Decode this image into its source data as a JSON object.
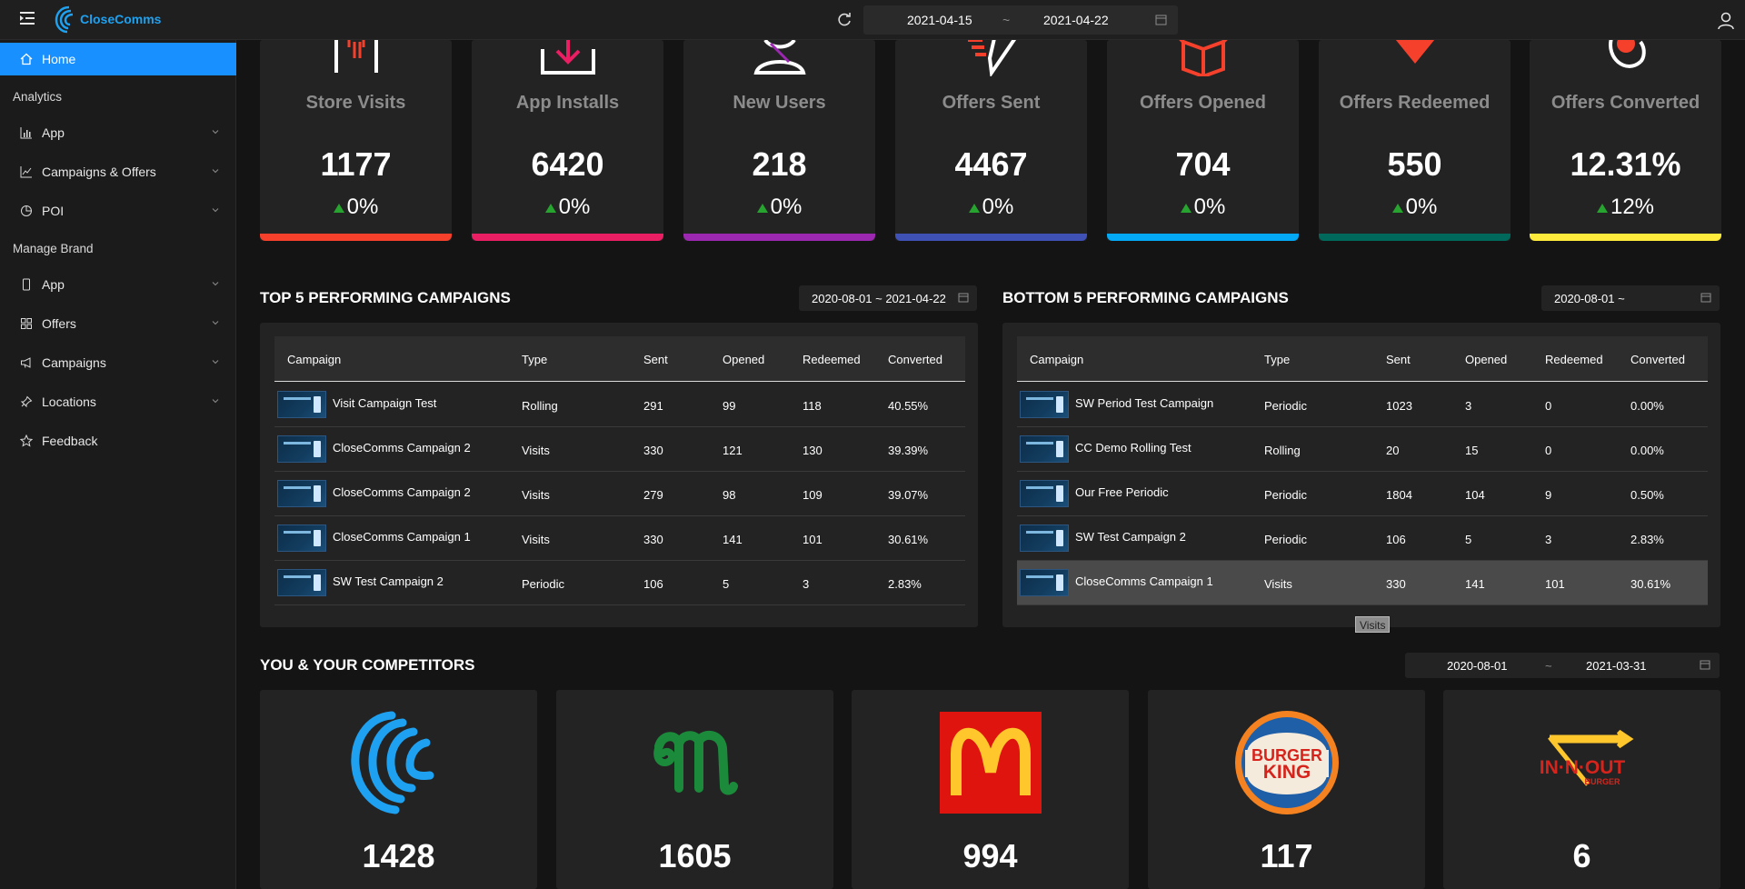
{
  "brand": {
    "name": "CloseComms"
  },
  "header": {
    "date_from": "2021-04-15",
    "date_sep": "~",
    "date_to": "2021-04-22"
  },
  "sidebar": {
    "home": "Home",
    "analytics_label": "Analytics",
    "analytics_items": [
      {
        "label": "App",
        "icon": "bar-chart-icon"
      },
      {
        "label": "Campaigns & Offers",
        "icon": "line-chart-icon"
      },
      {
        "label": "POI",
        "icon": "pie-chart-icon"
      }
    ],
    "manage_label": "Manage Brand",
    "manage_items": [
      {
        "label": "App",
        "icon": "mobile-icon"
      },
      {
        "label": "Offers",
        "icon": "grid-icon"
      },
      {
        "label": "Campaigns",
        "icon": "megaphone-icon"
      },
      {
        "label": "Locations",
        "icon": "pin-icon"
      }
    ],
    "feedback": "Feedback"
  },
  "stats": [
    {
      "title": "Store Visits",
      "value": "1177",
      "change": "0%",
      "color": "#f5402c"
    },
    {
      "title": "App Installs",
      "value": "6420",
      "change": "0%",
      "color": "#e91e63"
    },
    {
      "title": "New Users",
      "value": "218",
      "change": "0%",
      "color": "#9c27b0"
    },
    {
      "title": "Offers Sent",
      "value": "4467",
      "change": "0%",
      "color": "#3f51b5"
    },
    {
      "title": "Offers Opened",
      "value": "704",
      "change": "0%",
      "color": "#03a9f4"
    },
    {
      "title": "Offers Redeemed",
      "value": "550",
      "change": "0%",
      "color": "#00695c"
    },
    {
      "title": "Offers Converted",
      "value": "12.31%",
      "change": "12%",
      "color": "#ffeb3b"
    }
  ],
  "top5": {
    "title": "TOP 5 PERFORMING CAMPAIGNS",
    "range": "2020-08-01 ~ 2021-04-22",
    "columns": [
      "Campaign",
      "Type",
      "Sent",
      "Opened",
      "Redeemed",
      "Converted"
    ],
    "rows": [
      {
        "campaign": "Visit Campaign Test",
        "type": "Rolling",
        "sent": "291",
        "opened": "99",
        "redeemed": "118",
        "converted": "40.55%"
      },
      {
        "campaign": "CloseComms Campaign 2",
        "type": "Visits",
        "sent": "330",
        "opened": "121",
        "redeemed": "130",
        "converted": "39.39%"
      },
      {
        "campaign": "CloseComms Campaign 2",
        "type": "Visits",
        "sent": "279",
        "opened": "98",
        "redeemed": "109",
        "converted": "39.07%"
      },
      {
        "campaign": "CloseComms Campaign 1",
        "type": "Visits",
        "sent": "330",
        "opened": "141",
        "redeemed": "101",
        "converted": "30.61%"
      },
      {
        "campaign": "SW Test Campaign 2",
        "type": "Periodic",
        "sent": "106",
        "opened": "5",
        "redeemed": "3",
        "converted": "2.83%"
      }
    ]
  },
  "bottom5": {
    "title": "BOTTOM 5 PERFORMING CAMPAIGNS",
    "range": "2020-08-01 ~",
    "columns": [
      "Campaign",
      "Type",
      "Sent",
      "Opened",
      "Redeemed",
      "Converted"
    ],
    "rows": [
      {
        "campaign": "SW Period Test Campaign",
        "type": "Periodic",
        "sent": "1023",
        "opened": "3",
        "redeemed": "0",
        "converted": "0.00%"
      },
      {
        "campaign": "CC Demo Rolling Test",
        "type": "Rolling",
        "sent": "20",
        "opened": "15",
        "redeemed": "0",
        "converted": "0.00%"
      },
      {
        "campaign": "Our Free Periodic",
        "type": "Periodic",
        "sent": "1804",
        "opened": "104",
        "redeemed": "9",
        "converted": "0.50%"
      },
      {
        "campaign": "SW Test Campaign 2",
        "type": "Periodic",
        "sent": "106",
        "opened": "5",
        "redeemed": "3",
        "converted": "2.83%"
      },
      {
        "campaign": "CloseComms Campaign 1",
        "type": "Visits",
        "sent": "330",
        "opened": "141",
        "redeemed": "101",
        "converted": "30.61%"
      }
    ],
    "tooltip": "Visits"
  },
  "competitors": {
    "title": "YOU & YOUR COMPETITORS",
    "date_from": "2020-08-01",
    "date_sep": "~",
    "date_to": "2021-03-31",
    "items": [
      {
        "brand": "CloseComms",
        "value": "1428"
      },
      {
        "brand": "Nando's",
        "value": "1605"
      },
      {
        "brand": "McDonald's",
        "value": "994"
      },
      {
        "brand": "Burger King",
        "value": "117",
        "logo_text_1": "BURGER",
        "logo_text_2": "KING"
      },
      {
        "brand": "In-N-Out",
        "value": "6",
        "logo_text_1": "IN·N·OUT",
        "logo_text_2": "BURGER"
      }
    ]
  }
}
